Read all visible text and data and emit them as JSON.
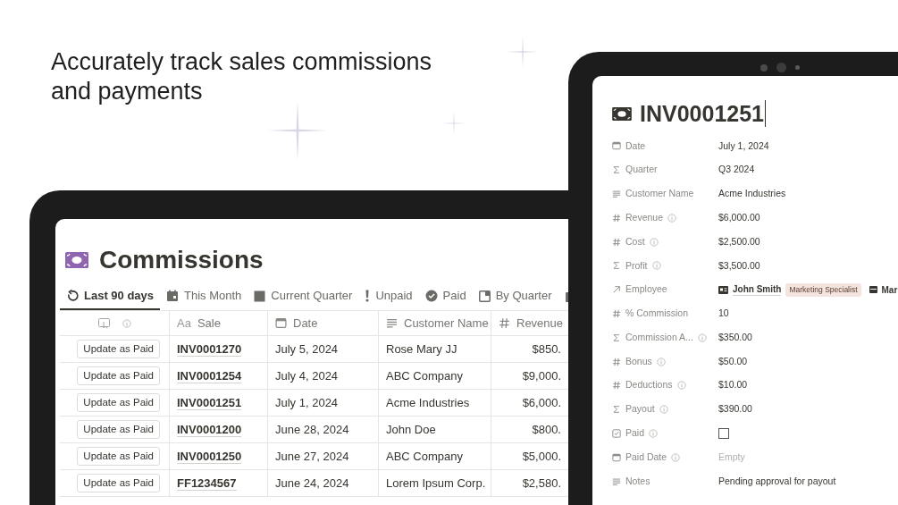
{
  "headline": "Accurately track sales commissions and payments",
  "table_view": {
    "title": "Commissions",
    "tabs": [
      {
        "label": "Last 90 days",
        "selected": true
      },
      {
        "label": "This Month",
        "selected": false
      },
      {
        "label": "Current Quarter",
        "selected": false
      },
      {
        "label": "Unpaid",
        "selected": false
      },
      {
        "label": "Paid",
        "selected": false
      },
      {
        "label": "By Quarter",
        "selected": false
      }
    ],
    "columns": [
      {
        "label": "Sale",
        "kind": "title",
        "type_label": "Aa"
      },
      {
        "label": "Date",
        "kind": "date"
      },
      {
        "label": "Customer Name",
        "kind": "text"
      },
      {
        "label": "Revenue",
        "kind": "number"
      }
    ],
    "rows": [
      {
        "action": "Update as Paid",
        "sale": "INV0001270",
        "date": "July 5, 2024",
        "customer": "Rose Mary JJ",
        "revenue": "$850."
      },
      {
        "action": "Update as Paid",
        "sale": "INV0001254",
        "date": "July 4, 2024",
        "customer": "ABC Company",
        "revenue": "$9,000."
      },
      {
        "action": "Update as Paid",
        "sale": "INV0001251",
        "date": "July 1, 2024",
        "customer": "Acme Industries",
        "revenue": "$6,000."
      },
      {
        "action": "Update as Paid",
        "sale": "INV0001200",
        "date": "June 28, 2024",
        "customer": "John Doe",
        "revenue": "$800."
      },
      {
        "action": "Update as Paid",
        "sale": "INV0001250",
        "date": "June 27, 2024",
        "customer": "ABC Company",
        "revenue": "$5,000."
      },
      {
        "action": "Update as Paid",
        "sale": "FF1234567",
        "date": "June 24, 2024",
        "customer": "Lorem Ipsum Corp.",
        "revenue": "$2,580."
      }
    ]
  },
  "record": {
    "title": "INV0001251",
    "properties": [
      {
        "kind": "date",
        "label": "Date",
        "info": false,
        "value": "July 1, 2024"
      },
      {
        "kind": "formula",
        "label": "Quarter",
        "info": false,
        "value": "Q3 2024"
      },
      {
        "kind": "text",
        "label": "Customer Name",
        "info": false,
        "value": "Acme Industries"
      },
      {
        "kind": "number",
        "label": "Revenue",
        "info": true,
        "value": "$6,000.00"
      },
      {
        "kind": "number",
        "label": "Cost",
        "info": true,
        "value": "$2,500.00"
      },
      {
        "kind": "formula",
        "label": "Profit",
        "info": true,
        "value": "$3,500.00"
      },
      {
        "kind": "relation",
        "label": "Employee",
        "info": false,
        "person": "John Smith",
        "tag": "Marketing Specialist",
        "more": "Mar"
      },
      {
        "kind": "number",
        "label": "% Commission",
        "info": false,
        "value": "10"
      },
      {
        "kind": "formula",
        "label": "Commission A...",
        "info": true,
        "value": "$350.00"
      },
      {
        "kind": "number",
        "label": "Bonus",
        "info": true,
        "value": "$50.00"
      },
      {
        "kind": "number",
        "label": "Deductions",
        "info": true,
        "value": "$10.00"
      },
      {
        "kind": "formula",
        "label": "Payout",
        "info": true,
        "value": "$390.00"
      },
      {
        "kind": "checkbox",
        "label": "Paid",
        "info": true,
        "checked": false
      },
      {
        "kind": "date",
        "label": "Paid Date",
        "info": true,
        "value": "Empty",
        "empty": true
      },
      {
        "kind": "text",
        "label": "Notes",
        "info": false,
        "value": "Pending approval for payout"
      }
    ]
  }
}
